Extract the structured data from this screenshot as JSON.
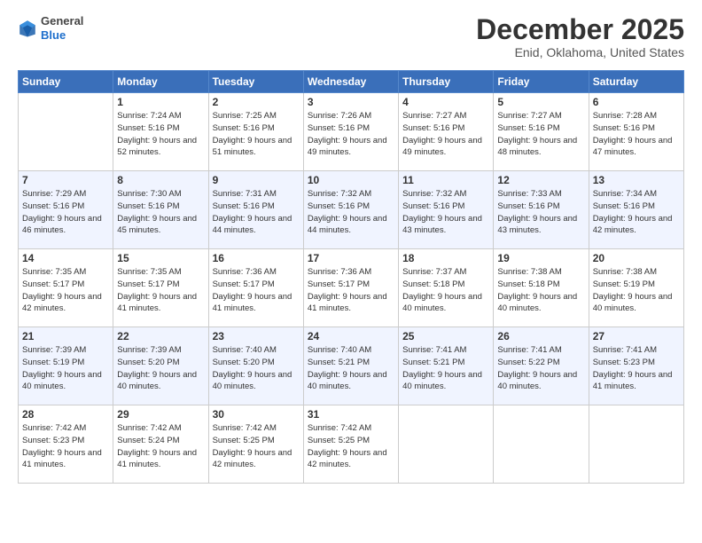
{
  "header": {
    "logo_general": "General",
    "logo_blue": "Blue",
    "month_title": "December 2025",
    "location": "Enid, Oklahoma, United States"
  },
  "weekdays": [
    "Sunday",
    "Monday",
    "Tuesday",
    "Wednesday",
    "Thursday",
    "Friday",
    "Saturday"
  ],
  "weeks": [
    [
      {
        "day": "",
        "sunrise": "",
        "sunset": "",
        "daylight": ""
      },
      {
        "day": "1",
        "sunrise": "Sunrise: 7:24 AM",
        "sunset": "Sunset: 5:16 PM",
        "daylight": "Daylight: 9 hours and 52 minutes."
      },
      {
        "day": "2",
        "sunrise": "Sunrise: 7:25 AM",
        "sunset": "Sunset: 5:16 PM",
        "daylight": "Daylight: 9 hours and 51 minutes."
      },
      {
        "day": "3",
        "sunrise": "Sunrise: 7:26 AM",
        "sunset": "Sunset: 5:16 PM",
        "daylight": "Daylight: 9 hours and 49 minutes."
      },
      {
        "day": "4",
        "sunrise": "Sunrise: 7:27 AM",
        "sunset": "Sunset: 5:16 PM",
        "daylight": "Daylight: 9 hours and 49 minutes."
      },
      {
        "day": "5",
        "sunrise": "Sunrise: 7:27 AM",
        "sunset": "Sunset: 5:16 PM",
        "daylight": "Daylight: 9 hours and 48 minutes."
      },
      {
        "day": "6",
        "sunrise": "Sunrise: 7:28 AM",
        "sunset": "Sunset: 5:16 PM",
        "daylight": "Daylight: 9 hours and 47 minutes."
      }
    ],
    [
      {
        "day": "7",
        "sunrise": "Sunrise: 7:29 AM",
        "sunset": "Sunset: 5:16 PM",
        "daylight": "Daylight: 9 hours and 46 minutes."
      },
      {
        "day": "8",
        "sunrise": "Sunrise: 7:30 AM",
        "sunset": "Sunset: 5:16 PM",
        "daylight": "Daylight: 9 hours and 45 minutes."
      },
      {
        "day": "9",
        "sunrise": "Sunrise: 7:31 AM",
        "sunset": "Sunset: 5:16 PM",
        "daylight": "Daylight: 9 hours and 44 minutes."
      },
      {
        "day": "10",
        "sunrise": "Sunrise: 7:32 AM",
        "sunset": "Sunset: 5:16 PM",
        "daylight": "Daylight: 9 hours and 44 minutes."
      },
      {
        "day": "11",
        "sunrise": "Sunrise: 7:32 AM",
        "sunset": "Sunset: 5:16 PM",
        "daylight": "Daylight: 9 hours and 43 minutes."
      },
      {
        "day": "12",
        "sunrise": "Sunrise: 7:33 AM",
        "sunset": "Sunset: 5:16 PM",
        "daylight": "Daylight: 9 hours and 43 minutes."
      },
      {
        "day": "13",
        "sunrise": "Sunrise: 7:34 AM",
        "sunset": "Sunset: 5:16 PM",
        "daylight": "Daylight: 9 hours and 42 minutes."
      }
    ],
    [
      {
        "day": "14",
        "sunrise": "Sunrise: 7:35 AM",
        "sunset": "Sunset: 5:17 PM",
        "daylight": "Daylight: 9 hours and 42 minutes."
      },
      {
        "day": "15",
        "sunrise": "Sunrise: 7:35 AM",
        "sunset": "Sunset: 5:17 PM",
        "daylight": "Daylight: 9 hours and 41 minutes."
      },
      {
        "day": "16",
        "sunrise": "Sunrise: 7:36 AM",
        "sunset": "Sunset: 5:17 PM",
        "daylight": "Daylight: 9 hours and 41 minutes."
      },
      {
        "day": "17",
        "sunrise": "Sunrise: 7:36 AM",
        "sunset": "Sunset: 5:17 PM",
        "daylight": "Daylight: 9 hours and 41 minutes."
      },
      {
        "day": "18",
        "sunrise": "Sunrise: 7:37 AM",
        "sunset": "Sunset: 5:18 PM",
        "daylight": "Daylight: 9 hours and 40 minutes."
      },
      {
        "day": "19",
        "sunrise": "Sunrise: 7:38 AM",
        "sunset": "Sunset: 5:18 PM",
        "daylight": "Daylight: 9 hours and 40 minutes."
      },
      {
        "day": "20",
        "sunrise": "Sunrise: 7:38 AM",
        "sunset": "Sunset: 5:19 PM",
        "daylight": "Daylight: 9 hours and 40 minutes."
      }
    ],
    [
      {
        "day": "21",
        "sunrise": "Sunrise: 7:39 AM",
        "sunset": "Sunset: 5:19 PM",
        "daylight": "Daylight: 9 hours and 40 minutes."
      },
      {
        "day": "22",
        "sunrise": "Sunrise: 7:39 AM",
        "sunset": "Sunset: 5:20 PM",
        "daylight": "Daylight: 9 hours and 40 minutes."
      },
      {
        "day": "23",
        "sunrise": "Sunrise: 7:40 AM",
        "sunset": "Sunset: 5:20 PM",
        "daylight": "Daylight: 9 hours and 40 minutes."
      },
      {
        "day": "24",
        "sunrise": "Sunrise: 7:40 AM",
        "sunset": "Sunset: 5:21 PM",
        "daylight": "Daylight: 9 hours and 40 minutes."
      },
      {
        "day": "25",
        "sunrise": "Sunrise: 7:41 AM",
        "sunset": "Sunset: 5:21 PM",
        "daylight": "Daylight: 9 hours and 40 minutes."
      },
      {
        "day": "26",
        "sunrise": "Sunrise: 7:41 AM",
        "sunset": "Sunset: 5:22 PM",
        "daylight": "Daylight: 9 hours and 40 minutes."
      },
      {
        "day": "27",
        "sunrise": "Sunrise: 7:41 AM",
        "sunset": "Sunset: 5:23 PM",
        "daylight": "Daylight: 9 hours and 41 minutes."
      }
    ],
    [
      {
        "day": "28",
        "sunrise": "Sunrise: 7:42 AM",
        "sunset": "Sunset: 5:23 PM",
        "daylight": "Daylight: 9 hours and 41 minutes."
      },
      {
        "day": "29",
        "sunrise": "Sunrise: 7:42 AM",
        "sunset": "Sunset: 5:24 PM",
        "daylight": "Daylight: 9 hours and 41 minutes."
      },
      {
        "day": "30",
        "sunrise": "Sunrise: 7:42 AM",
        "sunset": "Sunset: 5:25 PM",
        "daylight": "Daylight: 9 hours and 42 minutes."
      },
      {
        "day": "31",
        "sunrise": "Sunrise: 7:42 AM",
        "sunset": "Sunset: 5:25 PM",
        "daylight": "Daylight: 9 hours and 42 minutes."
      },
      {
        "day": "",
        "sunrise": "",
        "sunset": "",
        "daylight": ""
      },
      {
        "day": "",
        "sunrise": "",
        "sunset": "",
        "daylight": ""
      },
      {
        "day": "",
        "sunrise": "",
        "sunset": "",
        "daylight": ""
      }
    ]
  ]
}
